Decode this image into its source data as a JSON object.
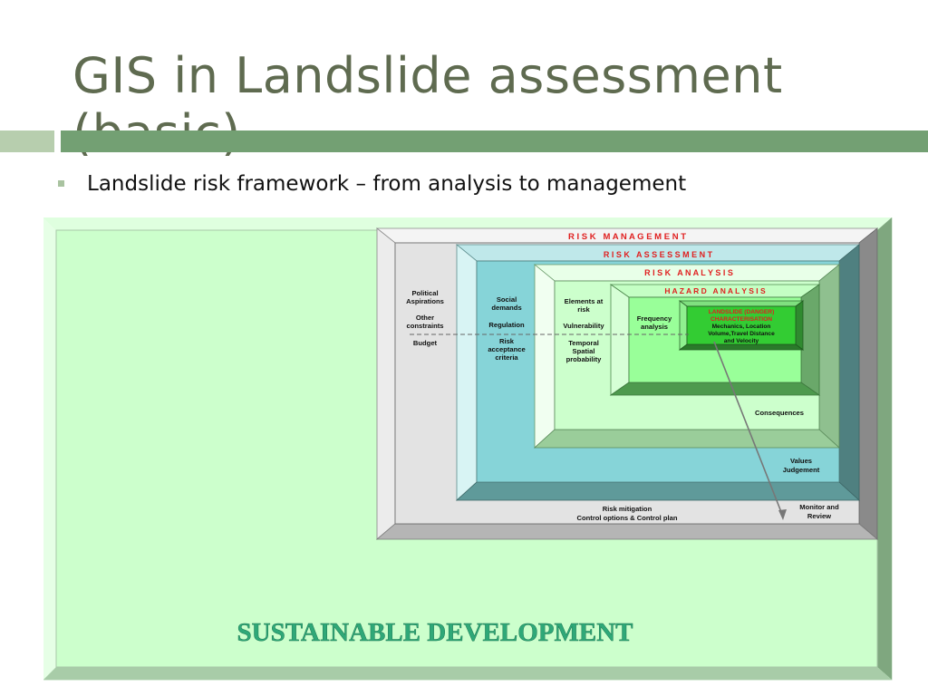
{
  "slide": {
    "title": "GIS in Landslide assessment (basic)",
    "bullet": "Landslide risk framework – from analysis to management"
  },
  "diagram": {
    "risk_management": "R I S K   M A N A G E M E N T",
    "risk_assessment": "R I S K   A S S E S S M E N T",
    "risk_analysis": "R I S K   A N A L Y S I S",
    "hazard_analysis": "H A Z A R D   A N A L Y S I S",
    "landslide": {
      "line1": "LANDSLIDE (DANGER)",
      "line2": "CHARACTERISATION",
      "line3": "Mechanics, Location",
      "line4": "Volume,Travel Distance",
      "line5": "and Velocity"
    },
    "management_col": {
      "political1": "Political",
      "political2": "Aspirations",
      "other1": "Other",
      "other2": "constraints",
      "budget": "Budget"
    },
    "assessment_col": {
      "social1": "Social",
      "social2": "demands",
      "regulation": "Regulation",
      "risk_accept1": "Risk",
      "risk_accept2": "acceptance",
      "risk_accept3": "criteria"
    },
    "analysis_col": {
      "elements1": "Elements at",
      "elements2": "risk",
      "vulnerability": "Vulnerability",
      "temporal1": "Temporal",
      "temporal2": "Spatial",
      "temporal3": "probability"
    },
    "frequency1": "Frequency",
    "frequency2": "analysis",
    "consequences": "Consequences",
    "values1": "Values",
    "values2": "Judgement",
    "mitigation1": "Risk mitigation",
    "mitigation2": "Control options & Control plan",
    "monitor1": "Monitor and",
    "monitor2": "Review",
    "sustainable": "SUSTAINABLE DEVELOPMENT"
  },
  "colors": {
    "title": "#5f6b50",
    "accent_bar": "#73a073",
    "outer_bg": "#ccffcc",
    "label_red": "#e02020"
  }
}
